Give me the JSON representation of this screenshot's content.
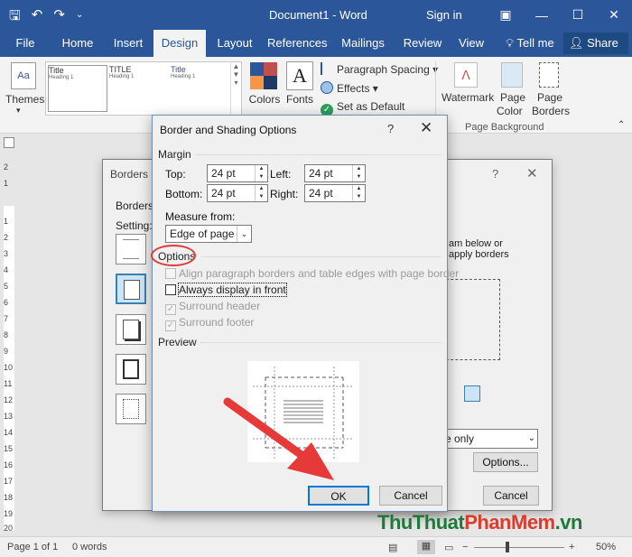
{
  "window": {
    "title": "Document1 - Word",
    "signin": "Sign in",
    "qat_icons": [
      "save-icon",
      "undo-icon",
      "redo-icon",
      "customize-icon"
    ]
  },
  "ribbon_tabs": [
    "File",
    "Home",
    "Insert",
    "Design",
    "Layout",
    "References",
    "Mailings",
    "Review",
    "View"
  ],
  "active_tab": "Design",
  "tellme": "Tell me",
  "share": "Share",
  "ribbon": {
    "themes": "Themes",
    "gallery": [
      {
        "title": "Title",
        "heading": "Heading 1"
      },
      {
        "title": "TITLE",
        "heading": "Heading 1"
      },
      {
        "title": "Title",
        "heading": "Heading 1"
      }
    ],
    "colors": "Colors",
    "fonts": "Fonts",
    "paragraph_spacing": "Paragraph Spacing",
    "effects": "Effects",
    "set_default": "Set as Default",
    "watermark": "Watermark",
    "page_color_1": "Page",
    "page_color_2": "Color",
    "page_borders_1": "Page",
    "page_borders_2": "Borders",
    "group_page_background": "Page Background"
  },
  "ruler_numbers": [
    "2",
    "1",
    "1",
    "2",
    "3",
    "4",
    "5",
    "6",
    "7",
    "8",
    "9",
    "10",
    "11",
    "12",
    "13",
    "14",
    "15",
    "16",
    "17",
    "18",
    "19",
    "20"
  ],
  "back_dialog": {
    "title": "Borders a",
    "tab": "Borders",
    "setting_label": "Setting:",
    "instruction_1": "am below or",
    "instruction_2": "apply borders",
    "apply_to": "e only",
    "options_button": "Options...",
    "cancel_button": "Cancel"
  },
  "dialog": {
    "title": "Border and Shading Options",
    "help": "?",
    "margin_label": "Margin",
    "top_label": "Top:",
    "top_value": "24 pt",
    "bottom_label": "Bottom:",
    "bottom_value": "24 pt",
    "left_label": "Left:",
    "left_value": "24 pt",
    "right_label": "Right:",
    "right_value": "24 pt",
    "measure_label": "Measure from:",
    "measure_value": "Edge of page",
    "options_label": "Options",
    "opt_align": "Align paragraph borders and table edges with page border",
    "opt_front": "Always display in front",
    "opt_header": "Surround header",
    "opt_footer": "Surround footer",
    "preview_label": "Preview",
    "ok_button": "OK",
    "cancel_button": "Cancel"
  },
  "status": {
    "page": "Page 1 of 1",
    "words": "0 words",
    "zoom": "50%"
  },
  "watermark": {
    "part1": "ThuThuat",
    "part2": "PhanMem",
    "part3": ".vn"
  }
}
